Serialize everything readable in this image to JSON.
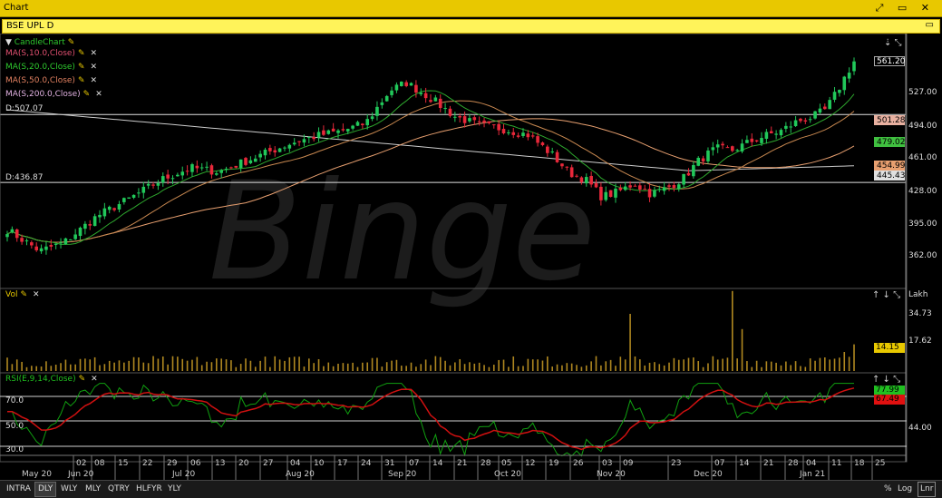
{
  "window": {
    "title": "Chart",
    "controls": "⤢ ▭ ✕"
  },
  "symbol_bar": {
    "symbol": "BSE UPL D",
    "window_icon": "▭"
  },
  "colors": {
    "up": "#21c85a",
    "down": "#e8283a",
    "ma10": "#2ea82e",
    "ma20": "#c88850",
    "ma50": "#e8a070",
    "ma200": "#cccccc",
    "volume": "#b08820",
    "rsi": "#d01010",
    "rsi_signal": "#10a010"
  },
  "price_panel": {
    "legend": [
      {
        "label": "CandleChart",
        "color": "#2ec82e"
      },
      {
        "label": "MA(S,10.0,Close)",
        "color": "#e05070"
      },
      {
        "label": "MA(S,20.0,Close)",
        "color": "#2ec82e"
      },
      {
        "label": "MA(S,50.0,Close)",
        "color": "#e08060"
      },
      {
        "label": "MA(S,200.0,Close)",
        "color": "#e0b0e0"
      }
    ],
    "lines": [
      {
        "label": "D:507.07",
        "value": 507.07
      },
      {
        "label": "D:436.87",
        "value": 436.87
      }
    ],
    "ticks": [
      "527.00",
      "494.00",
      "461.00",
      "428.00",
      "395.00",
      "362.00"
    ],
    "badges": [
      {
        "text": "561.20",
        "bg": "#000",
        "fg": "#fff",
        "border": "#aaa"
      },
      {
        "text": "501.28",
        "bg": "#e8b0a0",
        "fg": "#000",
        "border": "#e8b0a0"
      },
      {
        "text": "479.02",
        "bg": "#40c040",
        "fg": "#000",
        "border": "#40c040"
      },
      {
        "text": "454.99",
        "bg": "#e8a070",
        "fg": "#000",
        "border": "#e8a070"
      },
      {
        "text": "445.43",
        "bg": "#e0e0e0",
        "fg": "#000",
        "border": "#e0e0e0"
      }
    ],
    "watermark": "Binge"
  },
  "volume_panel": {
    "label": "Vol",
    "unit": "Lakh",
    "ticks": [
      "34.73",
      "17.62"
    ],
    "badge": "14.15"
  },
  "rsi_panel": {
    "label": "RSI(E,9,14,Close)",
    "levels": [
      "70.0",
      "50.0",
      "30.0"
    ],
    "ticks": [
      "44.00"
    ],
    "badges": [
      {
        "text": "77.99",
        "bg": "#20c020",
        "fg": "#000"
      },
      {
        "text": "67.49",
        "bg": "#e01010",
        "fg": "#000"
      }
    ]
  },
  "x_axis": {
    "days": [
      "02",
      "08",
      "15",
      "22",
      "29",
      "06",
      "13",
      "20",
      "27",
      "04",
      "10",
      "17",
      "24",
      "31",
      "07",
      "14",
      "21",
      "28",
      "05",
      "12",
      "19",
      "26",
      "03",
      "09",
      "23",
      "07",
      "14",
      "21",
      "28",
      "04",
      "11",
      "18",
      "25"
    ],
    "months": [
      "May 20",
      "Jun 20",
      "Jul 20",
      "Aug 20",
      "Sep 20",
      "Oct 20",
      "Nov 20",
      "Dec 20",
      "Jan 21"
    ]
  },
  "period_buttons": [
    {
      "label": "INTRA",
      "active": false
    },
    {
      "label": "DLY",
      "active": true
    },
    {
      "label": "WLY",
      "active": false
    },
    {
      "label": "MLY",
      "active": false
    },
    {
      "label": "QTRY",
      "active": false
    },
    {
      "label": "HLFYR",
      "active": false
    },
    {
      "label": "YLY",
      "active": false
    }
  ],
  "scale_buttons": [
    {
      "label": "%",
      "active": false
    },
    {
      "label": "Log",
      "active": false
    },
    {
      "label": "Lnr",
      "active": true
    }
  ]
}
